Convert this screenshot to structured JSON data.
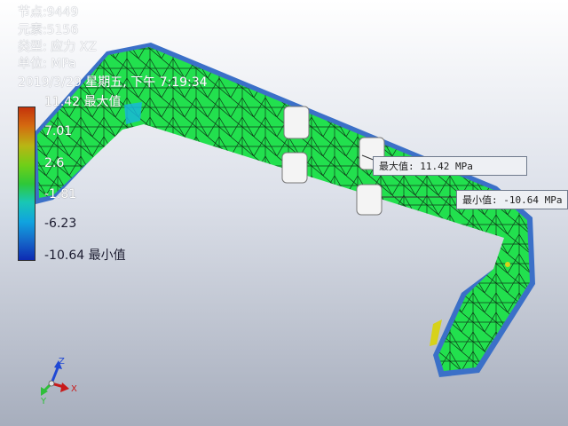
{
  "info": {
    "node_label": "节点:9449",
    "element_label": "元素:5156",
    "type_label": "类型: 应力 XZ",
    "unit_label": "单位: MPa",
    "datetime": "2019/3/29 星期五, 下午 7:19:34"
  },
  "legend": {
    "max_label": "11.42 最大值",
    "tick_2": "7.01",
    "tick_3": "2.6",
    "tick_4": "-1.81",
    "tick_5": "-6.23",
    "min_label": "-10.64 最小值"
  },
  "probes": {
    "max_text": "最大值: 11.42 MPa",
    "min_text": "最小值: -10.64 MPa"
  },
  "triad": {
    "x": "X",
    "y": "Y",
    "z": "Z"
  },
  "colors": {
    "mesh_fill": "#1ee34e",
    "mesh_line": "#0b2b14",
    "edge_blue": "#2a57b8",
    "x_axis": "#c81a1a",
    "y_axis": "#2fbf3a",
    "z_axis": "#1f48d4"
  }
}
